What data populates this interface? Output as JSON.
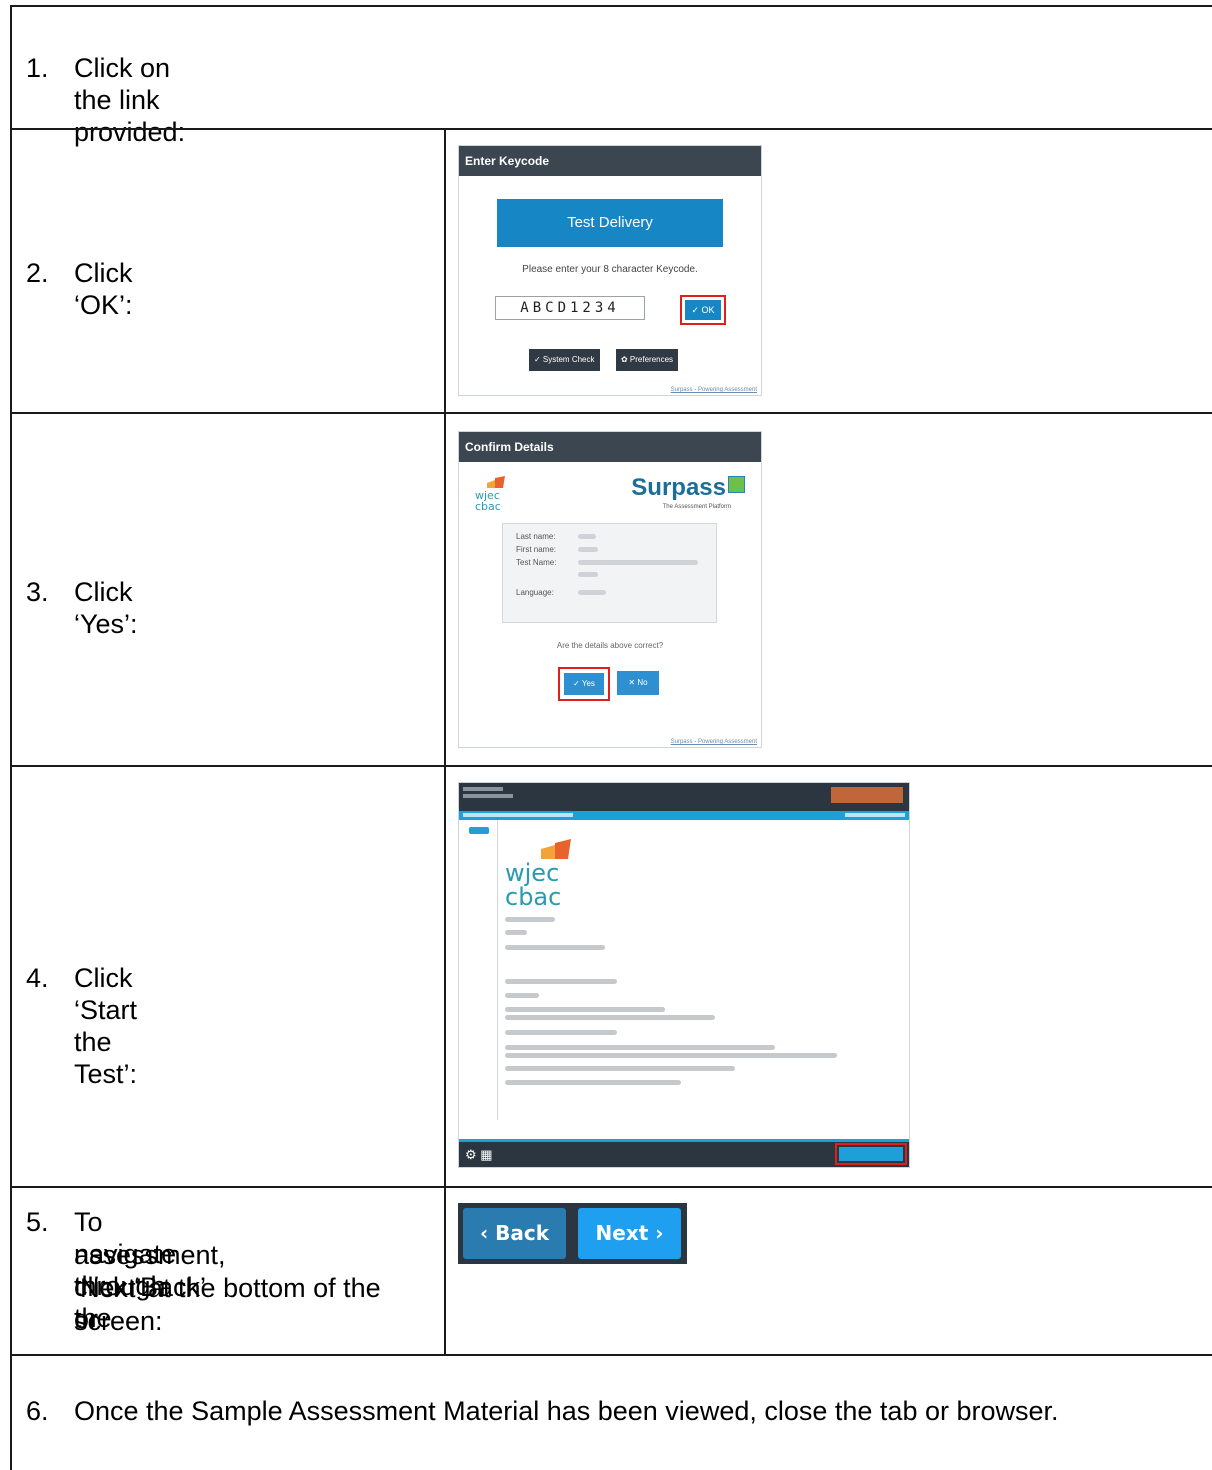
{
  "steps": [
    {
      "num": "1.",
      "text": "Click on the link provided:"
    },
    {
      "num": "2.",
      "text": "Click ‘OK’:"
    },
    {
      "num": "3.",
      "text": "Click ‘Yes’:"
    },
    {
      "num": "4.",
      "text": "Click ‘Start the Test’:"
    },
    {
      "num": "5.",
      "text_lines": [
        "To navigate through the",
        "assessment, click ‘Back’ or",
        "‘Next’ at the bottom of the",
        "screen:"
      ]
    },
    {
      "num": "6.",
      "text": "Once the Sample Assessment Material has been viewed, close the tab or browser."
    }
  ],
  "keycode_dialog": {
    "title": "Enter Keycode",
    "banner": "Test Delivery",
    "prompt": "Please enter your 8 character Keycode.",
    "keycode_value": "ABCD1234",
    "ok_label": "✓ OK",
    "system_check_label": "✓  System Check",
    "preferences_label": "✿  Preferences",
    "footer_link": "Surpass - Powering Assessment"
  },
  "confirm_dialog": {
    "title": "Confirm Details",
    "brand": "Surpass",
    "brand_sub": "The Assessment Platform",
    "logo_text": [
      "wjec",
      "cbac"
    ],
    "fields": [
      "Last name:",
      "First name:",
      "Test Name:",
      "Language:"
    ],
    "question": "Are the details above correct?",
    "yes_label": "✓  Yes",
    "no_label": "✕  No",
    "footer_link": "Surpass - Powering Assessment"
  },
  "intro_page": {
    "logo_text": [
      "wjec",
      "cbac"
    ]
  },
  "nav_buttons": {
    "back_label": "‹  Back",
    "next_label": "Next  ›"
  },
  "colors": {
    "primary_blue": "#1686c4",
    "dark_header": "#2b3640",
    "highlight_red": "#e11d1d",
    "finish_orange": "#c1663a"
  }
}
